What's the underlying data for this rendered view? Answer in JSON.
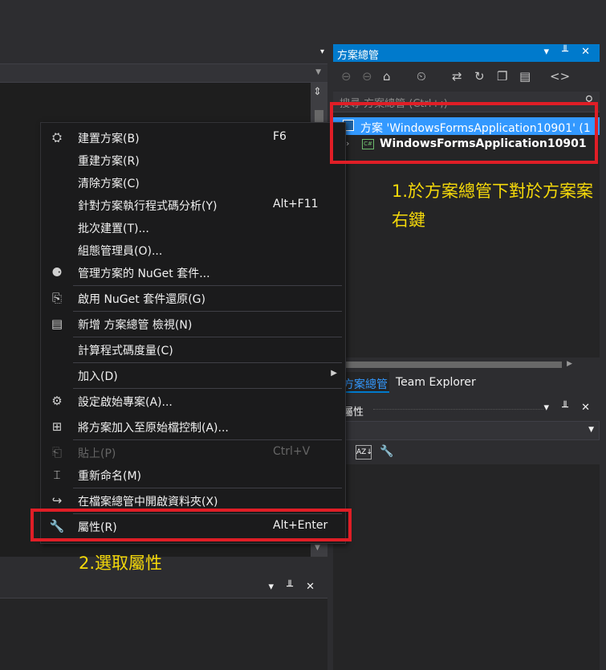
{
  "solution_explorer": {
    "title": "方案總管",
    "search_placeholder": "搜尋 方案總管 (Ctrl+;)",
    "solution_node": "方案 'WindowsFormsApplication10901' (1",
    "project_node": "WindowsFormsApplication10901",
    "project_icon": "C#",
    "tabs": [
      "方案總管",
      "Team Explorer"
    ]
  },
  "properties": {
    "title": "屬性"
  },
  "window_controls": {
    "dropdown": "▾",
    "pin": "╨",
    "close": "✕"
  },
  "context_menu": {
    "items": [
      {
        "label": "建置方案(B)",
        "shortcut": "F6",
        "icon": "build-icon"
      },
      {
        "label": "重建方案(R)",
        "shortcut": "",
        "icon": ""
      },
      {
        "label": "清除方案(C)",
        "shortcut": "",
        "icon": ""
      },
      {
        "label": "針對方案執行程式碼分析(Y)",
        "shortcut": "Alt+F11",
        "icon": ""
      },
      {
        "label": "批次建置(T)...",
        "shortcut": "",
        "icon": ""
      },
      {
        "label": "組態管理員(O)...",
        "shortcut": "",
        "icon": ""
      },
      {
        "label": "管理方案的 NuGet 套件...",
        "shortcut": "",
        "icon": "nuget-icon"
      },
      {
        "label": "啟用 NuGet 套件還原(G)",
        "shortcut": "",
        "icon": "package-restore-icon"
      },
      {
        "label": "新增 方案總管 檢視(N)",
        "shortcut": "",
        "icon": "new-view-icon"
      },
      {
        "label": "計算程式碼度量(C)",
        "shortcut": "",
        "icon": ""
      },
      {
        "label": "加入(D)",
        "shortcut": "",
        "icon": ""
      },
      {
        "label": "設定啟始專案(A)...",
        "shortcut": "",
        "icon": "gear-icon"
      },
      {
        "label": "將方案加入至原始檔控制(A)...",
        "shortcut": "",
        "icon": "source-control-icon"
      },
      {
        "label": "貼上(P)",
        "shortcut": "Ctrl+V",
        "icon": "paste-icon"
      },
      {
        "label": "重新命名(M)",
        "shortcut": "",
        "icon": "rename-icon"
      },
      {
        "label": "在檔案總管中開啟資料夾(X)",
        "shortcut": "",
        "icon": "open-folder-icon"
      },
      {
        "label": "屬性(R)",
        "shortcut": "Alt+Enter",
        "icon": "wrench-icon"
      }
    ]
  },
  "annotations": {
    "step1": "1.於方案總管下對於方案案右鍵",
    "step2": "2.選取屬性"
  },
  "colors": {
    "accent": "#007acc",
    "selection": "#3399ff",
    "annotation_text": "#f5d90a",
    "highlight_box": "#e01e26"
  }
}
